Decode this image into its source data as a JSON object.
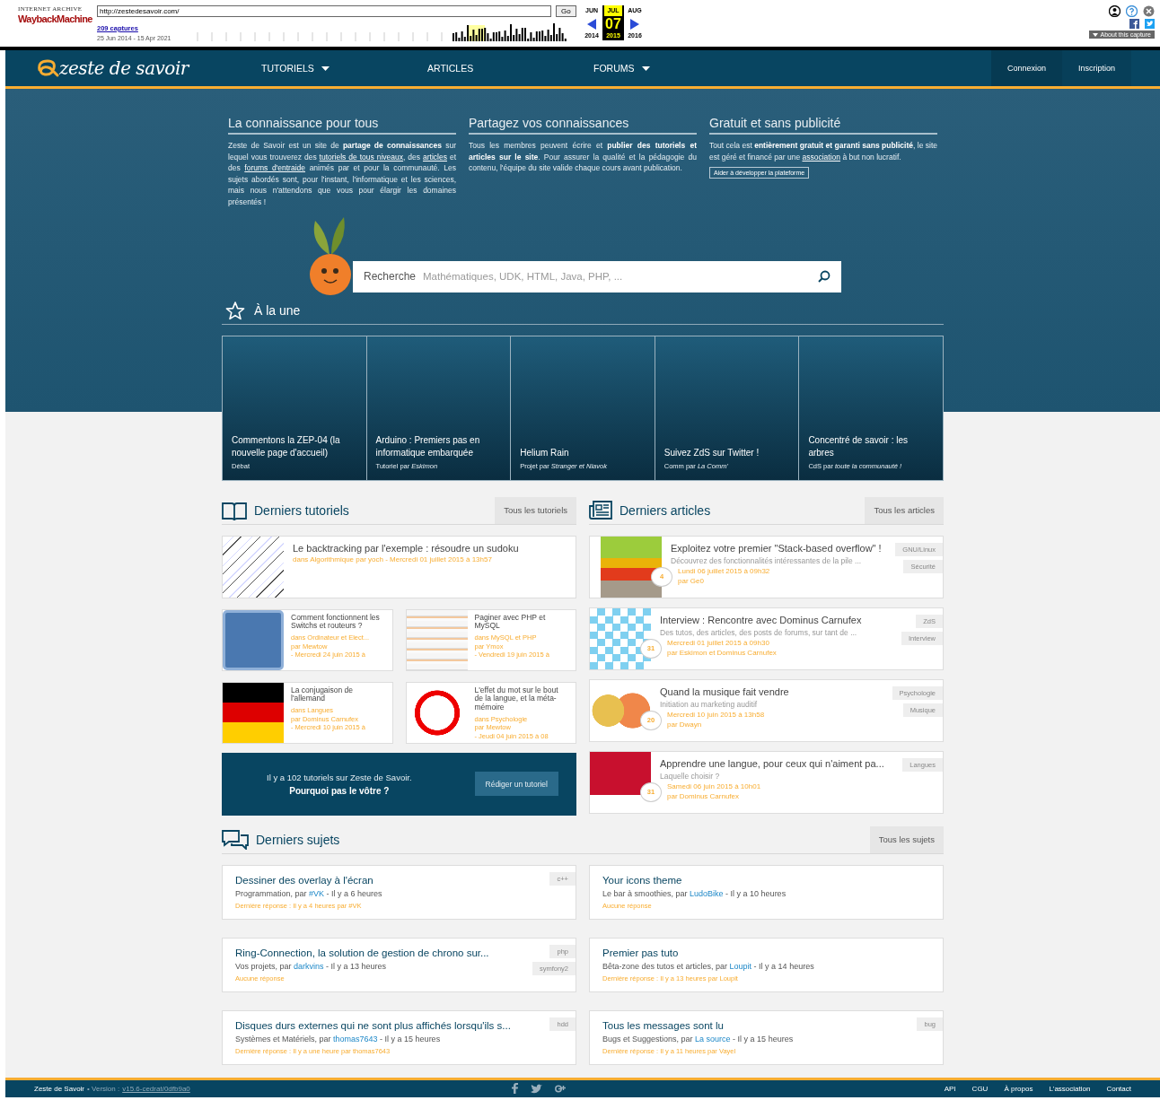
{
  "wayback": {
    "brand_top": "INTERNET ARCHIVE",
    "brand": "WaybackMachine",
    "url": "http://zestedesavoir.com/",
    "go": "Go",
    "captures": "209 captures",
    "range": "25 Jun 2014 - 15 Apr 2021",
    "months": [
      {
        "label": "JUN",
        "year": "2014",
        "selected": false
      },
      {
        "label": "JUL",
        "year": "2015",
        "selected": true,
        "day": "07"
      },
      {
        "label": "AUG",
        "year": "2016",
        "selected": false
      }
    ],
    "about": "About this capture"
  },
  "nav": {
    "logo": "zeste de savoir",
    "menu": [
      {
        "label": "TUTORIELS",
        "dropdown": true
      },
      {
        "label": "ARTICLES",
        "dropdown": false
      },
      {
        "label": "FORUMS",
        "dropdown": true
      }
    ],
    "auth": [
      "Connexion",
      "Inscription"
    ]
  },
  "hero": [
    {
      "title": "La connaissance pour tous",
      "segments": [
        {
          "kind": "text",
          "t": "Zeste de Savoir est un site de "
        },
        {
          "kind": "bold",
          "t": "partage de connaissances"
        },
        {
          "kind": "text",
          "t": " sur lequel vous trouverez des "
        },
        {
          "kind": "link",
          "t": "tutoriels de tous niveaux"
        },
        {
          "kind": "text",
          "t": ", des "
        },
        {
          "kind": "link",
          "t": "articles"
        },
        {
          "kind": "text",
          "t": " et des "
        },
        {
          "kind": "link",
          "t": "forums d'entraide"
        },
        {
          "kind": "text",
          "t": " animés par et pour la communauté. Les sujets abordés sont, pour l'instant, l'informatique et les sciences, mais nous n'attendons que vous pour élargir les domaines présentés !"
        }
      ]
    },
    {
      "title": "Partagez vos connaissances",
      "segments": [
        {
          "kind": "text",
          "t": "Tous les membres peuvent écrire et "
        },
        {
          "kind": "bold",
          "t": "publier des tutoriels et articles sur le site"
        },
        {
          "kind": "text",
          "t": ". Pour assurer la qualité et la pédagogie du contenu, l'équipe du site valide chaque cours avant publication."
        }
      ]
    },
    {
      "title": "Gratuit et sans publicité",
      "segments": [
        {
          "kind": "text",
          "t": "Tout cela est "
        },
        {
          "kind": "bold",
          "t": "entièrement gratuit et garanti sans publicité"
        },
        {
          "kind": "text",
          "t": ", le site est géré et financé par une "
        },
        {
          "kind": "link",
          "t": "association"
        },
        {
          "kind": "text",
          "t": " à but non lucratif."
        }
      ],
      "button": "Aider à développer la plateforme"
    }
  ],
  "search": {
    "label": "Recherche",
    "placeholder": "Mathématiques, UDK, HTML, Java, PHP, ..."
  },
  "featured": {
    "title": "À la une",
    "items": [
      {
        "title": "Commentons la ZEP-04 (la nouvelle page d'accueil)",
        "meta": "Débat"
      },
      {
        "title": "Arduino : Premiers pas en informatique embarquée",
        "meta": "Tutoriel par *Eskimon*"
      },
      {
        "title": "Helium Rain",
        "meta": "Projet par *Stranger et Niavok*"
      },
      {
        "title": "Suivez ZdS sur Twitter !",
        "meta": "Comm par *La Comm'*"
      },
      {
        "title": "Concentré de savoir : les arbres",
        "meta": "CdS par *toute la communauté !*"
      }
    ]
  },
  "tutorials": {
    "title": "Derniers tutoriels",
    "all": "Tous les tutoriels",
    "main": {
      "kind": "tree",
      "title": "Le backtracking par l'exemple : résoudre un sudoku",
      "meta": "dans Algorithmique par yoch - Mercredi 01 juillet 2015 à 13h57"
    },
    "items": [
      {
        "kind": "chip",
        "title": "Comment fonctionnent les Switchs et routeurs ?",
        "category": "dans Ordinateur et Elect...",
        "author": "par Mewtow",
        "date": "- Mercredi 24 juin 2015 à"
      },
      {
        "kind": "table",
        "title": "Paginer avec PHP et MySQL",
        "category": "dans MySQL et PHP",
        "author": "par Ymox",
        "date": "- Vendredi 19 juin 2015 à"
      },
      {
        "kind": "flag",
        "title": "La conjugaison de l'allemand",
        "category": "dans Langues",
        "author": "par Dominus Carnufex",
        "date": "- Mercredi 10 juin 2015 à"
      },
      {
        "kind": "nospeech",
        "title": "L'effet du mot sur le bout de la langue, et la méta-mémoire",
        "category": "dans Psychologie",
        "author": "par Mewtow",
        "date": "- Jeudi 04 juin 2015 à 08"
      }
    ],
    "promo": {
      "text": "Il y a 102 tutoriels sur Zeste de Savoir.",
      "strong": "Pourquoi pas le vôtre ?",
      "button": "Rédiger un tutoriel"
    }
  },
  "articles": {
    "title": "Derniers articles",
    "all": "Tous les articles",
    "items": [
      {
        "kind": "stack",
        "title": "Exploitez votre premier \"Stack-based overflow\" !",
        "desc": "Découvrez des fonctionnalités intéressantes de la pile ...",
        "date": "Lundi 06 juillet 2015 à 09h32",
        "author": "par Ge0",
        "comments": "4",
        "tags": [
          "GNU/Linux",
          "Sécurité"
        ]
      },
      {
        "kind": "pattern",
        "title": "Interview : Rencontre avec Dominus Carnufex",
        "desc": "Des tutos, des articles, des posts de forums, sur tant de ...",
        "date": "Mercredi 01 juillet 2015 à 09h30",
        "author": "par Eskimon et Dominus Carnufex",
        "comments": "31",
        "tags": [
          "ZdS",
          "Interview"
        ]
      },
      {
        "kind": "music",
        "title": "Quand la musique fait vendre",
        "desc": "Initiation au marketing auditif",
        "date": "Mercredi 10 juin 2015 à 13h58",
        "author": "par Dwayn",
        "comments": "20",
        "tags": [
          "Psychologie",
          "Musique"
        ]
      },
      {
        "kind": "red",
        "title": "Apprendre une langue, pour ceux qui n'aiment pa...",
        "desc": "Laquelle choisir ?",
        "date": "Samedi 06 juin 2015 à 10h01",
        "author": "par Dominus Carnufex",
        "comments": "31",
        "tags": [
          "Langues"
        ]
      }
    ]
  },
  "topics": {
    "title": "Derniers sujets",
    "all": "Tous les sujets",
    "items": [
      {
        "title": "Dessiner des overlay à l'écran",
        "forum": "Programmation, par",
        "author": "#VK",
        "age": "- Il y a 6 heures",
        "last": "Dernière réponse : Il y a 4 heures par #VK",
        "tags": [
          "c++"
        ]
      },
      {
        "title": "Your icons theme",
        "forum": "Le bar à smoothies, par",
        "author": "LudoBike",
        "age": "- Il y a 10 heures",
        "last": "Aucune réponse"
      },
      {
        "title": "Ring-Connection, la solution de gestion de chrono sur...",
        "forum": "Vos projets, par",
        "author": "darkvins",
        "age": "- Il y a 13 heures",
        "last": "Aucune réponse",
        "tags": [
          "php",
          "symfony2"
        ]
      },
      {
        "title": "Premier pas tuto",
        "forum": "Bêta-zone des tutos et articles, par",
        "author": "Loupit",
        "age": "- Il y a 14 heures",
        "last": "Dernière réponse : Il y a 13 heures par Loupit"
      },
      {
        "title": "Disques durs externes qui ne sont plus affichés lorsqu'ils s...",
        "forum": "Systèmes et Matériels, par",
        "author": "thomas7643",
        "age": "- Il y a 15 heures",
        "last": "Dernière réponse : Il y a une heure par thomas7643",
        "tags": [
          "hdd"
        ]
      },
      {
        "title": "Tous les messages sont lu",
        "forum": "Bugs et Suggestions, par",
        "author": "La source",
        "age": "- Il y a 15 heures",
        "last": "Dernière réponse : Il y a 11 heures par Vayel",
        "tags": [
          "bug"
        ]
      }
    ]
  },
  "footer": {
    "brand": "Zeste de Savoir",
    "version_label": "• Version :",
    "version": "v15.6-cedrat/0dfb9a0",
    "links": [
      "API",
      "CGU",
      "À propos",
      "L'association",
      "Contact"
    ]
  }
}
